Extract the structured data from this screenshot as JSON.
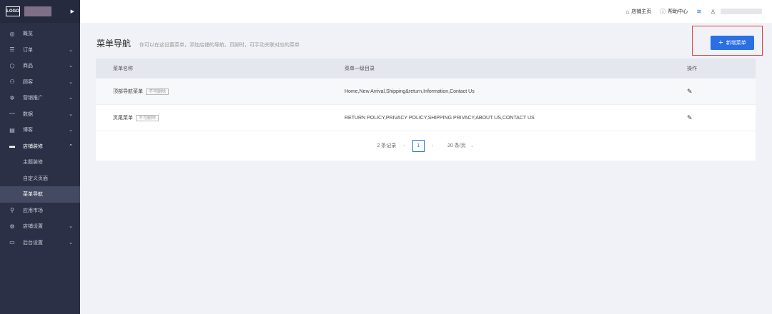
{
  "sidebar": {
    "logo_text": "LOGO",
    "items": [
      {
        "label": "概览",
        "icon": "◎",
        "chevron": ""
      },
      {
        "label": "订单",
        "icon": "☰",
        "chevron": "⌄"
      },
      {
        "label": "商品",
        "icon": "⬡",
        "chevron": "⌄"
      },
      {
        "label": "顾客",
        "icon": "⚇",
        "chevron": "⌄"
      },
      {
        "label": "营销推广",
        "icon": "✲",
        "chevron": "⌄"
      },
      {
        "label": "数据",
        "icon": "〰",
        "chevron": "⌄"
      },
      {
        "label": "博客",
        "icon": "▤",
        "chevron": "⌄"
      },
      {
        "label": "店铺装修",
        "icon": "▬",
        "chevron": "⌃"
      },
      {
        "label": "应用市场",
        "icon": "⚲",
        "chevron": ""
      },
      {
        "label": "店铺设置",
        "icon": "⚙",
        "chevron": "⌄"
      },
      {
        "label": "后台设置",
        "icon": "▭",
        "chevron": "⌄"
      }
    ],
    "sub_items": [
      "主题装修",
      "自定义页面",
      "菜单导航"
    ]
  },
  "topbar": {
    "store_home": "店铺主页",
    "help_center": "帮助中心"
  },
  "page": {
    "title": "菜单导航",
    "hint": "你可以在这设置菜单，添加店铺的导航、页脚时，可手动关联对应的菜单",
    "add_button": "新增菜单"
  },
  "table": {
    "headers": [
      "菜单名称",
      "菜单一级目录",
      "操作"
    ],
    "rows": [
      {
        "name": "顶部导航菜单",
        "tag": "不可删除",
        "items": "Home,New Arrival,Shipping&return,Information,Contact Us"
      },
      {
        "name": "页尾菜单",
        "tag": "不可删除",
        "items": "RETURN POLICY,PRIVACY POLICY,SHIPPING PRIVACY,ABOUT US,CONTACT US"
      }
    ]
  },
  "pagination": {
    "total": "2 条记录",
    "current_page": "1",
    "page_size": "20 条/页"
  },
  "colors": {
    "sidebar_bg": "#2b3046",
    "primary": "#2a6fe3",
    "highlight": "#e23b3b"
  }
}
